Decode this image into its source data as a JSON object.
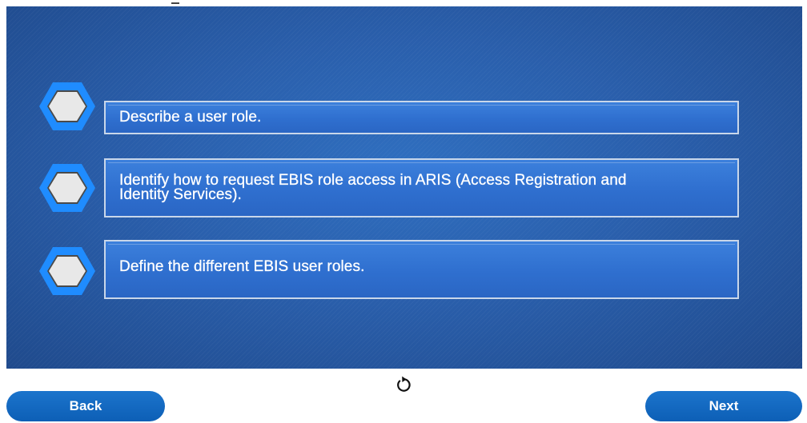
{
  "objectives": [
    {
      "text": "Describe a user role."
    },
    {
      "text": "Identify how to request EBIS role access in ARIS (Access Registration and Identity Services)."
    },
    {
      "text": "Define the different EBIS user roles."
    }
  ],
  "navigation": {
    "back_label": "Back",
    "next_label": "Next",
    "replay_icon": "replay-icon"
  },
  "colors": {
    "panel": "#2a5fac",
    "objective_box": "#3276d6",
    "objective_border": "#c9d7ea",
    "hex_outer": "#1e90ff",
    "hex_inner": "#e9e9e9",
    "button": "#0d64bd"
  }
}
